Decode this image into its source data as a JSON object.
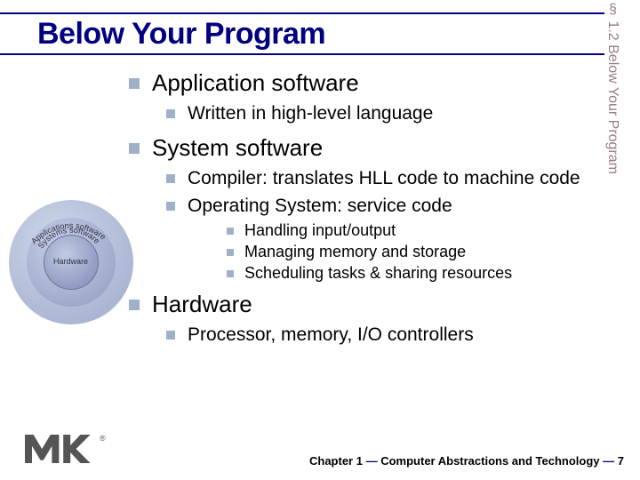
{
  "title": "Below Your Program",
  "side_label": "§ 1.2 Below Your Program",
  "bullets": {
    "app": "Application software",
    "app_sub1": "Written in high-level language",
    "sys": "System software",
    "sys_sub1": "Compiler: translates HLL code to machine code",
    "sys_sub2": "Operating System: service code",
    "os_sub1": "Handling input/output",
    "os_sub2": "Managing memory and storage",
    "os_sub3": "Scheduling tasks & sharing resources",
    "hw": "Hardware",
    "hw_sub1": "Processor, memory, I/O controllers"
  },
  "diagram": {
    "outer": "Applications software",
    "middle": "Systems software",
    "inner": "Hardware"
  },
  "footer": {
    "chapter": "Chapter 1",
    "chapter_title": "Computer Abstractions and Technology",
    "page": "7"
  }
}
